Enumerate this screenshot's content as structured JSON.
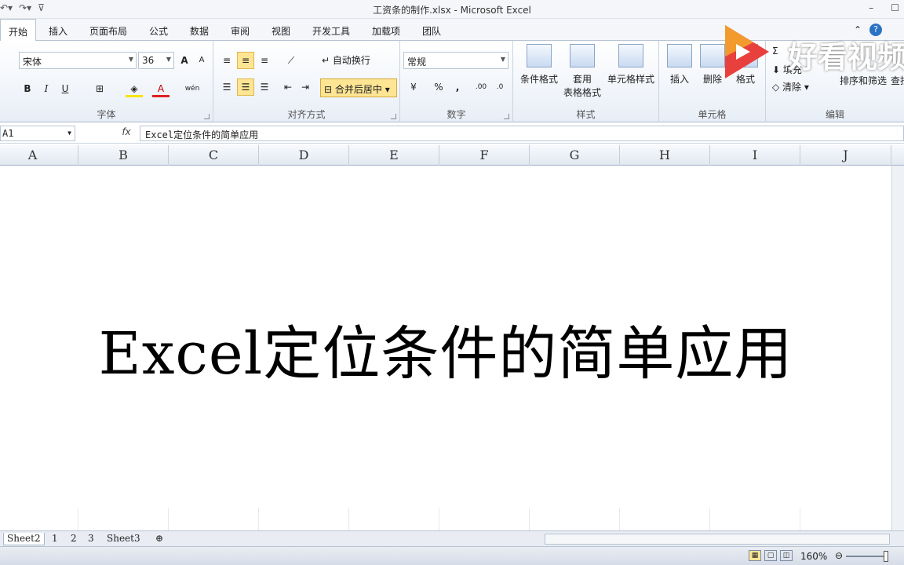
{
  "titlebar": {
    "title": "工资条的制作.xlsx  -  Microsoft Excel"
  },
  "tabs": [
    {
      "label": "开始",
      "active": true
    },
    {
      "label": "插入"
    },
    {
      "label": "页面布局"
    },
    {
      "label": "公式"
    },
    {
      "label": "数据"
    },
    {
      "label": "审阅"
    },
    {
      "label": "视图"
    },
    {
      "label": "开发工具"
    },
    {
      "label": "加载项"
    },
    {
      "label": "团队"
    }
  ],
  "ribbon": {
    "font": {
      "name": "宋体",
      "size": "36",
      "group_label": "字体",
      "bold": "B",
      "italic": "I",
      "underline": "U",
      "grow": "A",
      "shrink": "A",
      "phonetic": "wén"
    },
    "align": {
      "group_label": "对齐方式",
      "wrap_label": "自动换行",
      "merge_label": "合并后居中"
    },
    "number": {
      "group_label": "数字",
      "format": "常规",
      "percent": "%",
      "comma": ",",
      "inc_decimal": ".00",
      "dec_decimal": ".0"
    },
    "styles": {
      "group_label": "样式",
      "cond_format": "条件格式",
      "table_format_1": "套用",
      "table_format_2": "表格格式",
      "cell_styles": "单元格样式"
    },
    "cells": {
      "group_label": "单元格",
      "insert": "插入",
      "delete": "删除",
      "format": "格式"
    },
    "editing": {
      "group_label": "编辑",
      "fill": "填充",
      "clear": "清除",
      "sort_filter": "排序和筛选",
      "find": "查找"
    }
  },
  "formula_bar": {
    "name_box": "A1",
    "fx": "fx",
    "content": "Excel定位条件的简单应用"
  },
  "columns": [
    "A",
    "B",
    "C",
    "D",
    "E",
    "F",
    "G",
    "H",
    "I",
    "J"
  ],
  "cell_text": "Excel定位条件的简单应用",
  "sheets": [
    {
      "name": "Sheet2",
      "active": true
    },
    {
      "name": "1"
    },
    {
      "name": "2"
    },
    {
      "name": "3"
    },
    {
      "name": "Sheet3"
    }
  ],
  "status": {
    "zoom": "160%"
  },
  "watermark": {
    "text": "好看视频",
    "brand_color": "#e8413d"
  }
}
